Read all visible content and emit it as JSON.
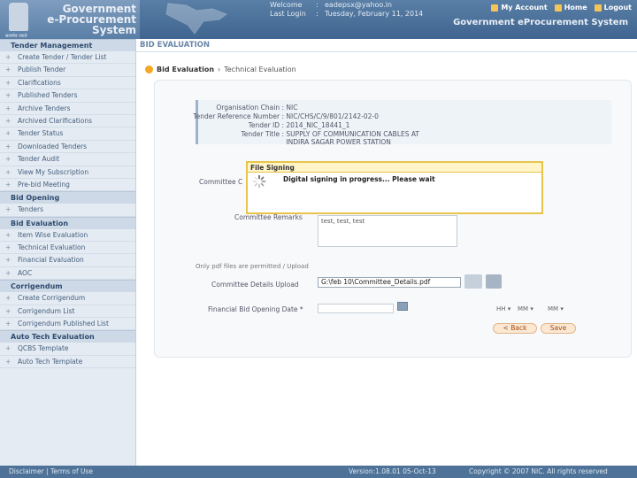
{
  "header": {
    "logo_lines": [
      "Government",
      "e-Procurement",
      "System"
    ],
    "emblem_caption": "सत्यमेव जयते",
    "welcome_label": "Welcome",
    "welcome_value": "eadepsx@yahoo.in",
    "lastlogin_label": "Last Login",
    "lastlogin_value": "Tuesday, February 11, 2014",
    "links": [
      "My Account",
      "Home",
      "Logout"
    ],
    "system_title": "Government eProcurement System"
  },
  "sidebar": {
    "sections": [
      {
        "title": "Tender Management",
        "items": [
          "Create Tender / Tender List",
          "Publish Tender",
          "Clarifications",
          "Published Tenders",
          "Archive Tenders",
          "Archived Clarifications",
          "Tender Status",
          "Downloaded Tenders",
          "Tender Audit",
          "View My Subscription",
          "Pre-bid Meeting"
        ]
      },
      {
        "title": "Bid Opening",
        "items": [
          "Tenders"
        ]
      },
      {
        "title": "Bid Evaluation",
        "items": [
          "Item Wise Evaluation",
          "Technical Evaluation",
          "Financial Evaluation",
          "AOC"
        ]
      },
      {
        "title": "Corrigendum",
        "items": [
          "Create Corrigendum",
          "Corrigendum List",
          "Corrigendum Published List"
        ]
      },
      {
        "title": "Auto Tech Evaluation",
        "items": [
          "QCBS Template",
          "Auto Tech Template"
        ]
      }
    ]
  },
  "main": {
    "section_title": "BID EVALUATION",
    "breadcrumb": [
      "Bid Evaluation",
      "Technical Evaluation"
    ],
    "details": [
      {
        "label": "Organisation Chain :",
        "value": "NIC"
      },
      {
        "label": "Tender Reference Number :",
        "value": "NIC/CHS/C/9/801/2142-02-0"
      },
      {
        "label": "Tender ID :",
        "value": "2014_NIC_18441_1"
      },
      {
        "label": "Tender Title :",
        "value": "SUPPLY OF COMMUNICATION CABLES AT INDIRA SAGAR POWER STATION"
      }
    ],
    "form": {
      "committee_label_1": "Committee C",
      "committee_label_2": "C",
      "remarks_label": "Committee Remarks",
      "remarks_value": "test, test, test",
      "note": "Only pdf files are permitted / Upload",
      "upload_label": "Committee Details Upload",
      "upload_value": "G:\\feb 10\\Committee_Details.pdf",
      "fin_date_label": "Financial Bid Opening Date *",
      "hh": "HH",
      "mm": "MM",
      "back_label": "< Back",
      "save_label": "Save"
    }
  },
  "dialog": {
    "title": "File Signing",
    "message": "Digital signing in progress... Please wait"
  },
  "footer": {
    "left": "Disclaimer  |  Terms of Use",
    "version": "Version:1.08.01 05-Oct-13",
    "copyright": "Copyright © 2007 NIC. All rights reserved"
  }
}
